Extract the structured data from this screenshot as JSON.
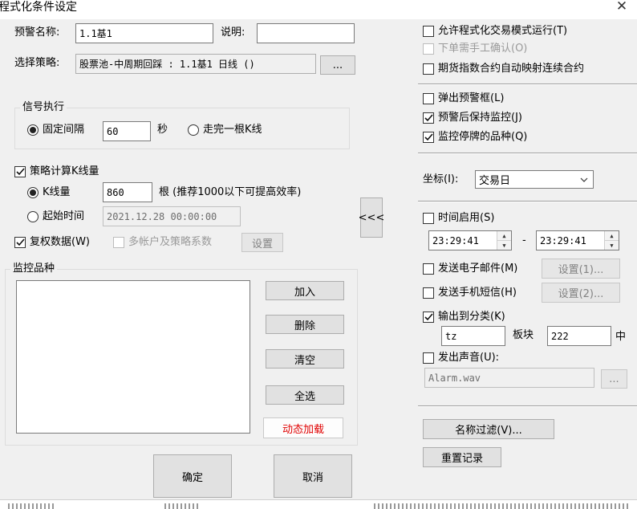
{
  "window": {
    "title": "程式化条件设定",
    "close_glyph": "✕"
  },
  "header": {
    "alert_name_label": "预警名称:",
    "alert_name_value": "1.1基1",
    "desc_label": "说明:",
    "desc_value": "",
    "strategy_label": "选择策略:",
    "strategy_value": "股票池-中周期回踩 : 1.1基1 日线 ()",
    "browse_label": "..."
  },
  "signal": {
    "legend": "信号执行",
    "fixed_interval_label": "固定间隔",
    "interval_value": "60",
    "seconds_label": "秒",
    "finish_bar_label": "走完一根K线"
  },
  "strategy_kline": {
    "label": "策略计算K线量",
    "kline_count_label": "K线量",
    "kline_count_value": "860",
    "kline_hint": "根 (推荐1000以下可提高效率)",
    "start_time_label": "起始时间",
    "start_time_value": "2021.12.28 00:00:00",
    "adjusted_label": "复权数据(W)",
    "multi_account_label": "多帐户及策略系数",
    "settings_label": "设置"
  },
  "monitor": {
    "legend": "监控品种",
    "add_label": "加入",
    "delete_label": "删除",
    "clear_label": "清空",
    "select_all_label": "全选",
    "dynamic_load_label": "动态加载",
    "collapse_label": "<<<"
  },
  "right": {
    "allow_program_trading": "允许程式化交易模式运行(T)",
    "manual_confirm": "下单需手工确认(O)",
    "futures_index_map": "期货指数合约自动映射连续合约",
    "popup_alert": "弹出预警框(L)",
    "keep_monitoring": "预警后保持监控(J)",
    "monitor_suspended": "监控停牌的品种(Q)",
    "axis_label": "坐标(I):",
    "axis_value": "交易日",
    "time_enable": "时间启用(S)",
    "time_start": "23:29:41",
    "time_dash": "-",
    "time_end": "23:29:41",
    "send_email": "发送电子邮件(M)",
    "email_settings": "设置(1)...",
    "send_sms": "发送手机短信(H)",
    "sms_settings": "设置(2)...",
    "output_category": "输出到分类(K)",
    "category_value": "tz",
    "block_label": "板块",
    "block_value": "222",
    "block_suffix": "中",
    "play_sound": "发出声音(U):",
    "sound_file": "Alarm.wav",
    "sound_browse": "...",
    "name_filter": "名称过滤(V)...",
    "reset_log": "重置记录"
  },
  "footer": {
    "ok_label": "确定",
    "cancel_label": "取消"
  },
  "checks": {
    "allow_program_trading": false,
    "manual_confirm": false,
    "futures_index_map": false,
    "popup_alert": false,
    "keep_monitoring": true,
    "monitor_suspended": true,
    "time_enable": false,
    "send_email": false,
    "send_sms": false,
    "output_category": true,
    "play_sound": false,
    "strategy_kline": true,
    "adjusted": true,
    "multi_account": false
  }
}
